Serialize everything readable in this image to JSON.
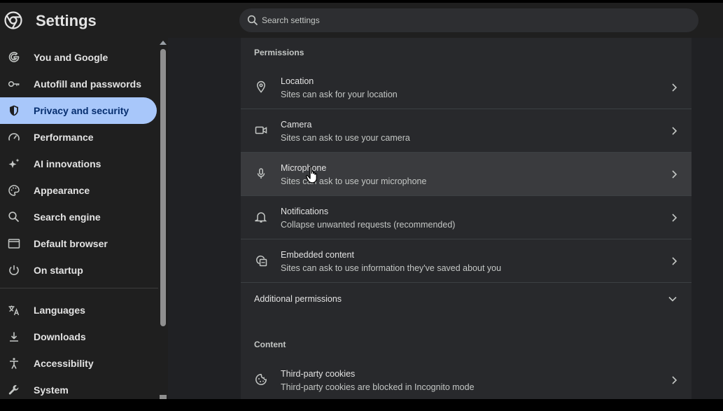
{
  "header": {
    "title": "Settings",
    "search_placeholder": "Search settings"
  },
  "sidebar": {
    "items": [
      {
        "label": "You and Google",
        "icon": "google-g-icon"
      },
      {
        "label": "Autofill and passwords",
        "icon": "key-icon"
      },
      {
        "label": "Privacy and security",
        "icon": "shield-icon",
        "active": true
      },
      {
        "label": "Performance",
        "icon": "speedometer-icon"
      },
      {
        "label": "AI innovations",
        "icon": "sparkle-icon"
      },
      {
        "label": "Appearance",
        "icon": "palette-icon"
      },
      {
        "label": "Search engine",
        "icon": "search-icon"
      },
      {
        "label": "Default browser",
        "icon": "browser-window-icon"
      },
      {
        "label": "On startup",
        "icon": "power-icon"
      },
      {
        "label": "Languages",
        "icon": "translate-icon"
      },
      {
        "label": "Downloads",
        "icon": "download-icon"
      },
      {
        "label": "Accessibility",
        "icon": "accessibility-icon"
      },
      {
        "label": "System",
        "icon": "wrench-icon"
      }
    ]
  },
  "main": {
    "permissions_title": "Permissions",
    "permissions": [
      {
        "title": "Location",
        "subtitle": "Sites can ask for your location",
        "icon": "location-pin-icon"
      },
      {
        "title": "Camera",
        "subtitle": "Sites can ask to use your camera",
        "icon": "video-camera-icon"
      },
      {
        "title": "Microphone",
        "subtitle": "Sites can ask to use your microphone",
        "icon": "microphone-icon",
        "hovered": true
      },
      {
        "title": "Notifications",
        "subtitle": "Collapse unwanted requests (recommended)",
        "icon": "bell-icon"
      },
      {
        "title": "Embedded content",
        "subtitle": "Sites can ask to use information they've saved about you",
        "icon": "embedded-content-icon"
      }
    ],
    "additional_permissions": "Additional permissions",
    "content_title": "Content",
    "content": [
      {
        "title": "Third-party cookies",
        "subtitle": "Third-party cookies are blocked in Incognito mode",
        "icon": "cookie-icon"
      }
    ]
  },
  "colors": {
    "accent": "#a8c7fa",
    "background": "#202124",
    "card": "#28292c",
    "hover_row": "#3a3b3e"
  }
}
